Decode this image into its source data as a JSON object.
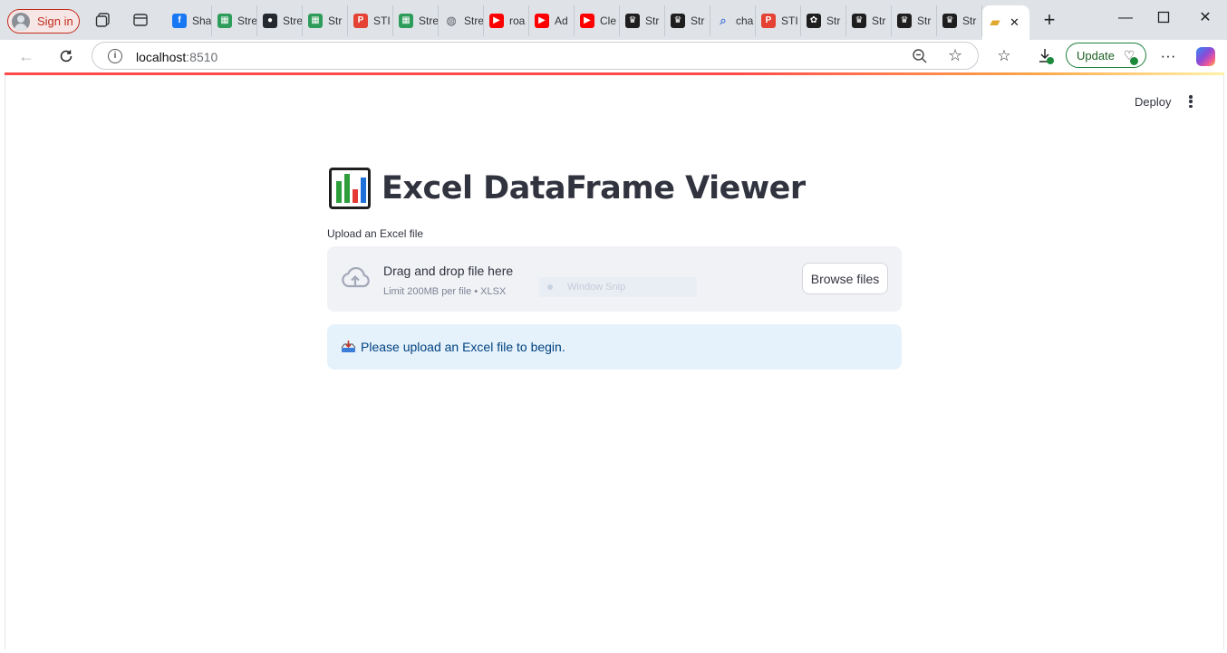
{
  "browser": {
    "signin_label": "Sign in",
    "tabs": [
      {
        "title": "Sha",
        "icon": "facebook-icon",
        "color": "#1877f2"
      },
      {
        "title": "Stre",
        "icon": "sheets-icon",
        "color": "#2e9c5b"
      },
      {
        "title": "Stre",
        "icon": "github-icon",
        "color": "#24292f"
      },
      {
        "title": "Str",
        "icon": "sheets-icon",
        "color": "#2e9c5b"
      },
      {
        "title": "STI",
        "icon": "pdf-icon",
        "color": "#e34234"
      },
      {
        "title": "Stre",
        "icon": "sheets-icon",
        "color": "#2e9c5b"
      },
      {
        "title": "Stre",
        "icon": "globe-icon",
        "color": "#5f6368"
      },
      {
        "title": "roa",
        "icon": "youtube-icon",
        "color": "#ff0000"
      },
      {
        "title": "Ad",
        "icon": "youtube-icon",
        "color": "#ff0000"
      },
      {
        "title": "Cle",
        "icon": "youtube-icon",
        "color": "#ff0000"
      },
      {
        "title": "Str",
        "icon": "streamlit-crown-icon",
        "color": "#1e1e1e"
      },
      {
        "title": "Str",
        "icon": "streamlit-crown-icon",
        "color": "#1e1e1e"
      },
      {
        "title": "cha",
        "icon": "search-icon",
        "color": "#4a7ad9"
      },
      {
        "title": "STI",
        "icon": "pdf-icon",
        "color": "#e34234"
      },
      {
        "title": "Str",
        "icon": "openai-icon",
        "color": "#1e1e1e"
      },
      {
        "title": "Str",
        "icon": "streamlit-crown-icon",
        "color": "#1e1e1e"
      },
      {
        "title": "Str",
        "icon": "streamlit-crown-icon",
        "color": "#1e1e1e"
      },
      {
        "title": "Str",
        "icon": "streamlit-crown-icon",
        "color": "#1e1e1e"
      }
    ],
    "active_tab": {
      "icon": "folder-icon",
      "close": "✕"
    },
    "url_host": "localhost",
    "url_port": ":8510",
    "update_label": "Update"
  },
  "app": {
    "deploy_label": "Deploy",
    "title": "Excel DataFrame Viewer",
    "uploader": {
      "label": "Upload an Excel file",
      "main_text": "Drag and drop file here",
      "sub_text": "Limit 200MB per file • XLSX",
      "browse_label": "Browse files",
      "overlay_text": "Window Snip"
    },
    "info_message": "Please upload an Excel file to begin."
  },
  "colors": {
    "accent": "#ff4b4b",
    "info_bg": "#e6f2fb",
    "info_text": "#004280",
    "dropzone_bg": "#f0f2f6"
  }
}
